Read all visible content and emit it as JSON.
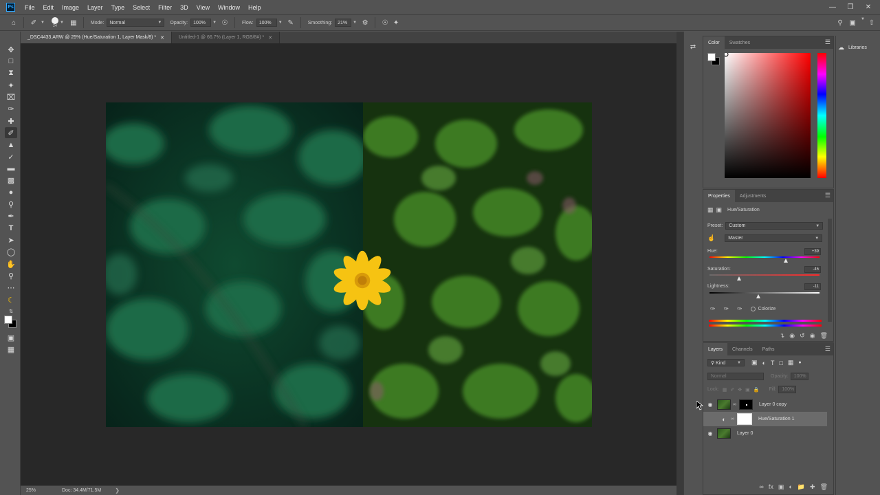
{
  "app": {
    "logo_text": "Ps"
  },
  "menu": [
    "File",
    "Edit",
    "Image",
    "Layer",
    "Type",
    "Select",
    "Filter",
    "3D",
    "View",
    "Window",
    "Help"
  ],
  "options_bar": {
    "brush_size": "24",
    "mode_label": "Mode:",
    "mode_value": "Normal",
    "opacity_label": "Opacity:",
    "opacity_value": "100%",
    "flow_label": "Flow:",
    "flow_value": "100%",
    "smoothing_label": "Smoothing:",
    "smoothing_value": "21%"
  },
  "tabs": [
    {
      "label": "_DSC4433.ARW @ 25% (Hue/Saturation 1, Layer Mask/8) *",
      "active": true
    },
    {
      "label": "Untitled-1 @ 66.7% (Layer 1, RGB/8#) *",
      "active": false
    }
  ],
  "status": {
    "zoom": "25%",
    "doc": "Doc: 34.4M/71.5M"
  },
  "color_panel": {
    "tabs": [
      "Color",
      "Swatches"
    ],
    "foreground": "#ffffff",
    "background": "#000000",
    "field_hue": "#ff0000"
  },
  "properties": {
    "tabs": [
      "Properties",
      "Adjustments"
    ],
    "adjustment_name": "Hue/Saturation",
    "preset_label": "Preset:",
    "preset_value": "Custom",
    "channel_value": "Master",
    "hue_label": "Hue:",
    "hue_value": "+39",
    "saturation_label": "Saturation:",
    "saturation_value": "-45",
    "lightness_label": "Lightness:",
    "lightness_value": "-11",
    "colorize_label": "Colorize"
  },
  "layers": {
    "tabs": [
      "Layers",
      "Channels",
      "Paths"
    ],
    "filter_label": "Kind",
    "blend_mode": "Normal",
    "opacity_label": "Opacity:",
    "opacity_value": "100%",
    "lock_label": "Lock:",
    "fill_label": "Fill:",
    "fill_value": "100%",
    "items": [
      {
        "name": "Layer 0 copy",
        "visible": true,
        "selected": false
      },
      {
        "name": "Hue/Saturation 1",
        "visible": false,
        "selected": true
      },
      {
        "name": "Layer 0",
        "visible": true,
        "selected": false
      }
    ]
  },
  "libraries": {
    "label": "Libraries"
  }
}
